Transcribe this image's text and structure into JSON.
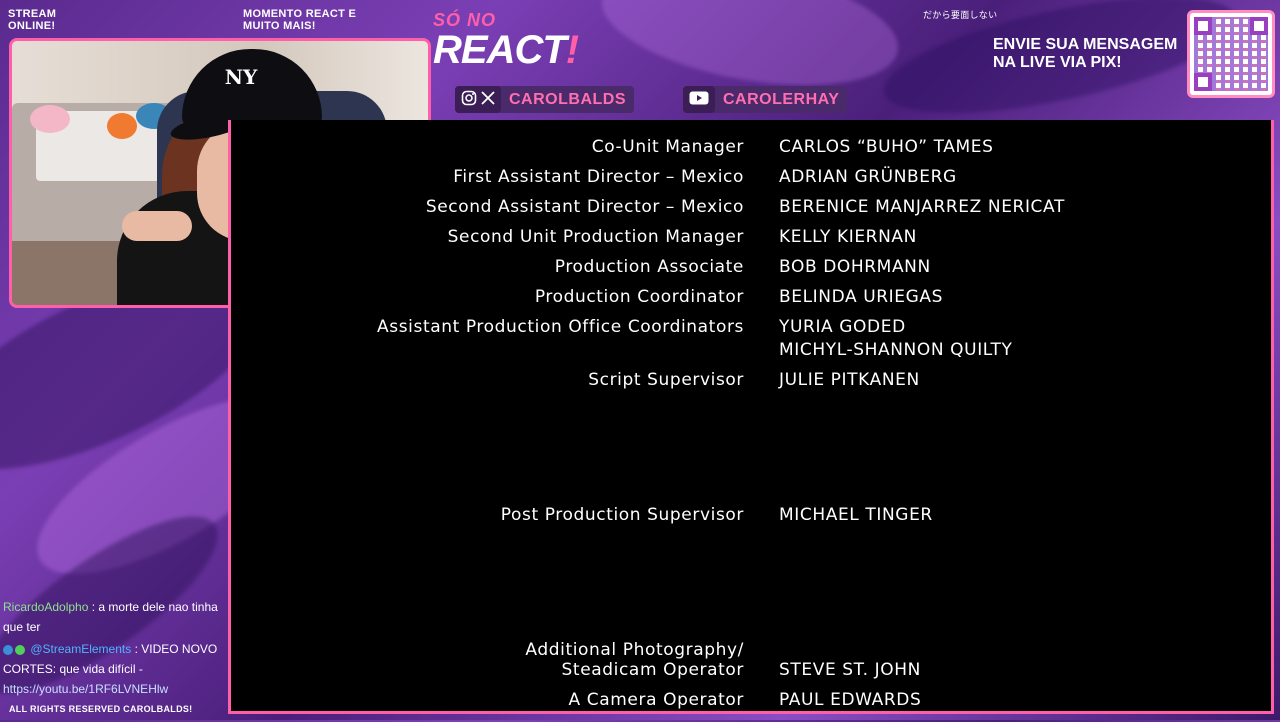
{
  "overlay": {
    "stream_status": "STREAM ONLINE!",
    "tagline": "MOMENTO REACT E MUITO MAIS!",
    "japanese_text": "だから要面しない",
    "logo_top": "SÓ",
    "logo_top_accent": "NO",
    "logo_main": "REACT",
    "logo_main_accent": "!",
    "pix_message": "ENVIE SUA MENSAGEM NA LIVE VIA PIX!",
    "rights": "ALL RIGHTS RESERVED CAROLBALDS!",
    "accent_color": "#ff5fa8"
  },
  "socials": [
    {
      "icons": [
        "instagram-icon",
        "x-icon"
      ],
      "handle": "CAROLBALDS"
    },
    {
      "icons": [
        "youtube-icon"
      ],
      "handle": "CAROLERHAY"
    }
  ],
  "credits": [
    {
      "role": "Co-Unit Manager",
      "names": [
        "CARLOS “BUHO” TAMES"
      ]
    },
    {
      "role": "First Assistant Director – Mexico",
      "names": [
        "ADRIAN GRÜNBERG"
      ]
    },
    {
      "role": "Second Assistant Director – Mexico",
      "names": [
        "BERENICE MANJARREZ NERICAT"
      ]
    },
    {
      "role": "Second Unit Production Manager",
      "names": [
        "KELLY KIERNAN"
      ]
    },
    {
      "role": "Production Associate",
      "names": [
        "BOB DOHRMANN"
      ]
    },
    {
      "role": "Production Coordinator",
      "names": [
        "BELINDA URIEGAS"
      ]
    },
    {
      "role": "Assistant Production Office Coordinators",
      "names": [
        "YURIA GODED",
        "MICHYL-SHANNON QUILTY"
      ]
    },
    {
      "role": "Script Supervisor",
      "names": [
        "JULIE PITKANEN"
      ]
    },
    {
      "role": "Post Production Supervisor",
      "names": [
        "MICHAEL TINGER"
      ]
    },
    {
      "role": "Additional Photography/",
      "names": []
    },
    {
      "role": "Steadicam Operator",
      "names": [
        "STEVE ST. JOHN"
      ]
    },
    {
      "role": "A Camera Operator",
      "names": [
        "PAUL EDWARDS"
      ]
    }
  ],
  "chat": [
    {
      "user": "RicardoAdolpho",
      "message": ": a morte dele nao tinha que ter"
    },
    {
      "user": "@StreamElements",
      "message": ": VIDEO NOVO CORTES: que vida difícil -",
      "link": "https://youtu.be/1RF6LVNEHlw"
    }
  ]
}
